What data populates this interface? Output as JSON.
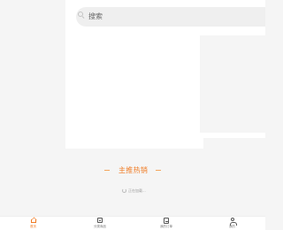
{
  "search": {
    "placeholder": "搜索"
  },
  "section": {
    "title": "主推热销"
  },
  "loading": {
    "text": "正在加载..."
  },
  "tabs": [
    {
      "label": "首页",
      "icon": "home-icon",
      "active": true
    },
    {
      "label": "分类商品",
      "icon": "category-icon",
      "active": false
    },
    {
      "label": "我的订单",
      "icon": "orders-icon",
      "active": false
    },
    {
      "label": "我的",
      "icon": "user-icon",
      "active": false
    }
  ],
  "colors": {
    "accent": "#f07b24",
    "background": "#f5f5f5",
    "search_bg": "#efefef"
  }
}
